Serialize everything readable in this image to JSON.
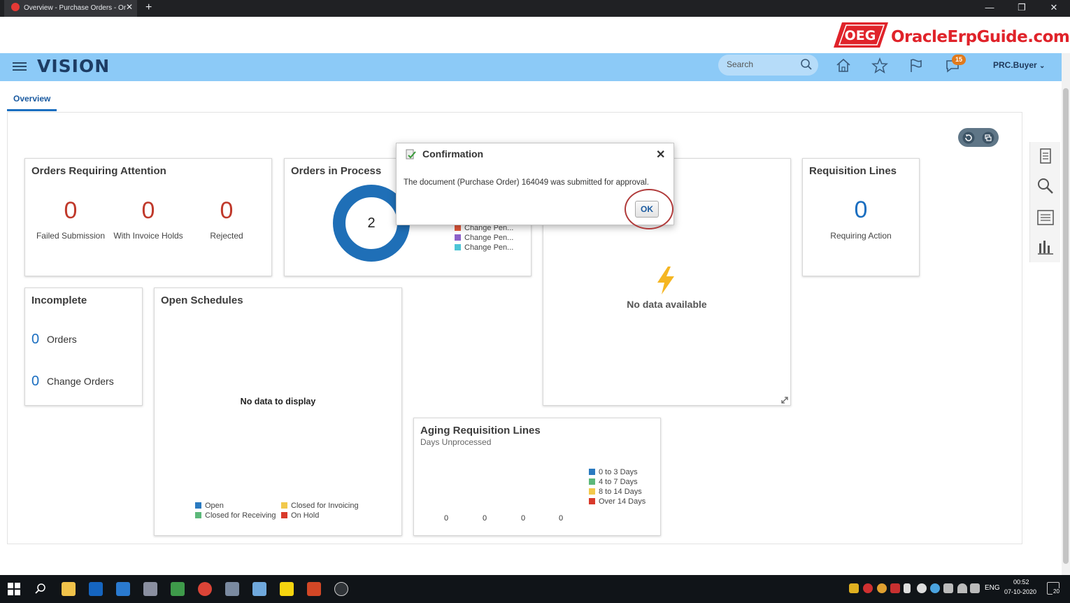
{
  "browser": {
    "tab_title": "Overview - Purchase Orders - Or",
    "close_glyph": "✕",
    "new_tab_glyph": "+",
    "minimize_glyph": "—",
    "restore_glyph": "❐",
    "close_window_glyph": "✕"
  },
  "banner": {
    "badge": "OEG",
    "text": "OracleErpGuide.com",
    "color": "#e0232a"
  },
  "header": {
    "logo": "VISION",
    "search_placeholder": "Search",
    "notification_count": "15",
    "user": "PRC.Buyer",
    "bg_color": "#8ccaf7"
  },
  "tabs": {
    "overview": "Overview"
  },
  "cards": {
    "orders_attention": {
      "title": "Orders Requiring Attention",
      "items": [
        {
          "value": "0",
          "label": "Failed Submission"
        },
        {
          "value": "0",
          "label": "With Invoice Holds"
        },
        {
          "value": "0",
          "label": "Rejected"
        }
      ]
    },
    "orders_in_process": {
      "title": "Orders in Process",
      "total": "2",
      "legend": [
        {
          "label": "Change Pen...",
          "color": "#e1573a"
        },
        {
          "label": "Change Pen...",
          "color": "#8c62c9"
        },
        {
          "label": "Change Pen...",
          "color": "#4dc5d6"
        }
      ]
    },
    "no_data_card": {
      "message": "No data available"
    },
    "requisition_lines": {
      "title": "Requisition Lines",
      "value": "0",
      "label": "Requiring Action"
    },
    "incomplete": {
      "title": "Incomplete",
      "rows": [
        {
          "value": "0",
          "label": "Orders"
        },
        {
          "value": "0",
          "label": "Change Orders"
        }
      ]
    },
    "open_schedules": {
      "title": "Open Schedules",
      "message": "No data to display",
      "legend": [
        {
          "label": "Open",
          "color": "#2a7ac0"
        },
        {
          "label": "Closed for Invoicing",
          "color": "#f2c94c"
        },
        {
          "label": "Closed for Receiving",
          "color": "#5cb87a"
        },
        {
          "label": "On Hold",
          "color": "#d93a2b"
        }
      ]
    },
    "aging_requisition": {
      "title": "Aging Requisition Lines",
      "subtitle": "Days Unprocessed",
      "legend": [
        {
          "label": "0 to 3 Days",
          "color": "#2a7ac0"
        },
        {
          "label": "4 to 7 Days",
          "color": "#5cb87a"
        },
        {
          "label": "8 to 14 Days",
          "color": "#f2c94c"
        },
        {
          "label": "Over 14 Days",
          "color": "#d93a2b"
        }
      ],
      "values": [
        "0",
        "0",
        "0",
        "0"
      ]
    }
  },
  "dialog": {
    "title": "Confirmation",
    "message": "The document (Purchase Order) 164049 was submitted for approval.",
    "ok_label": "OK",
    "close_glyph": "✕"
  },
  "taskbar": {
    "language": "ENG",
    "time": "00:52",
    "date": "07-10-2020",
    "notification_count": "20"
  },
  "chart_data": {
    "type": "pie",
    "title": "Orders in Process",
    "categories": [
      "Change Pen...",
      "Change Pen...",
      "Change Pen..."
    ],
    "values": [
      2
    ],
    "total": 2
  }
}
